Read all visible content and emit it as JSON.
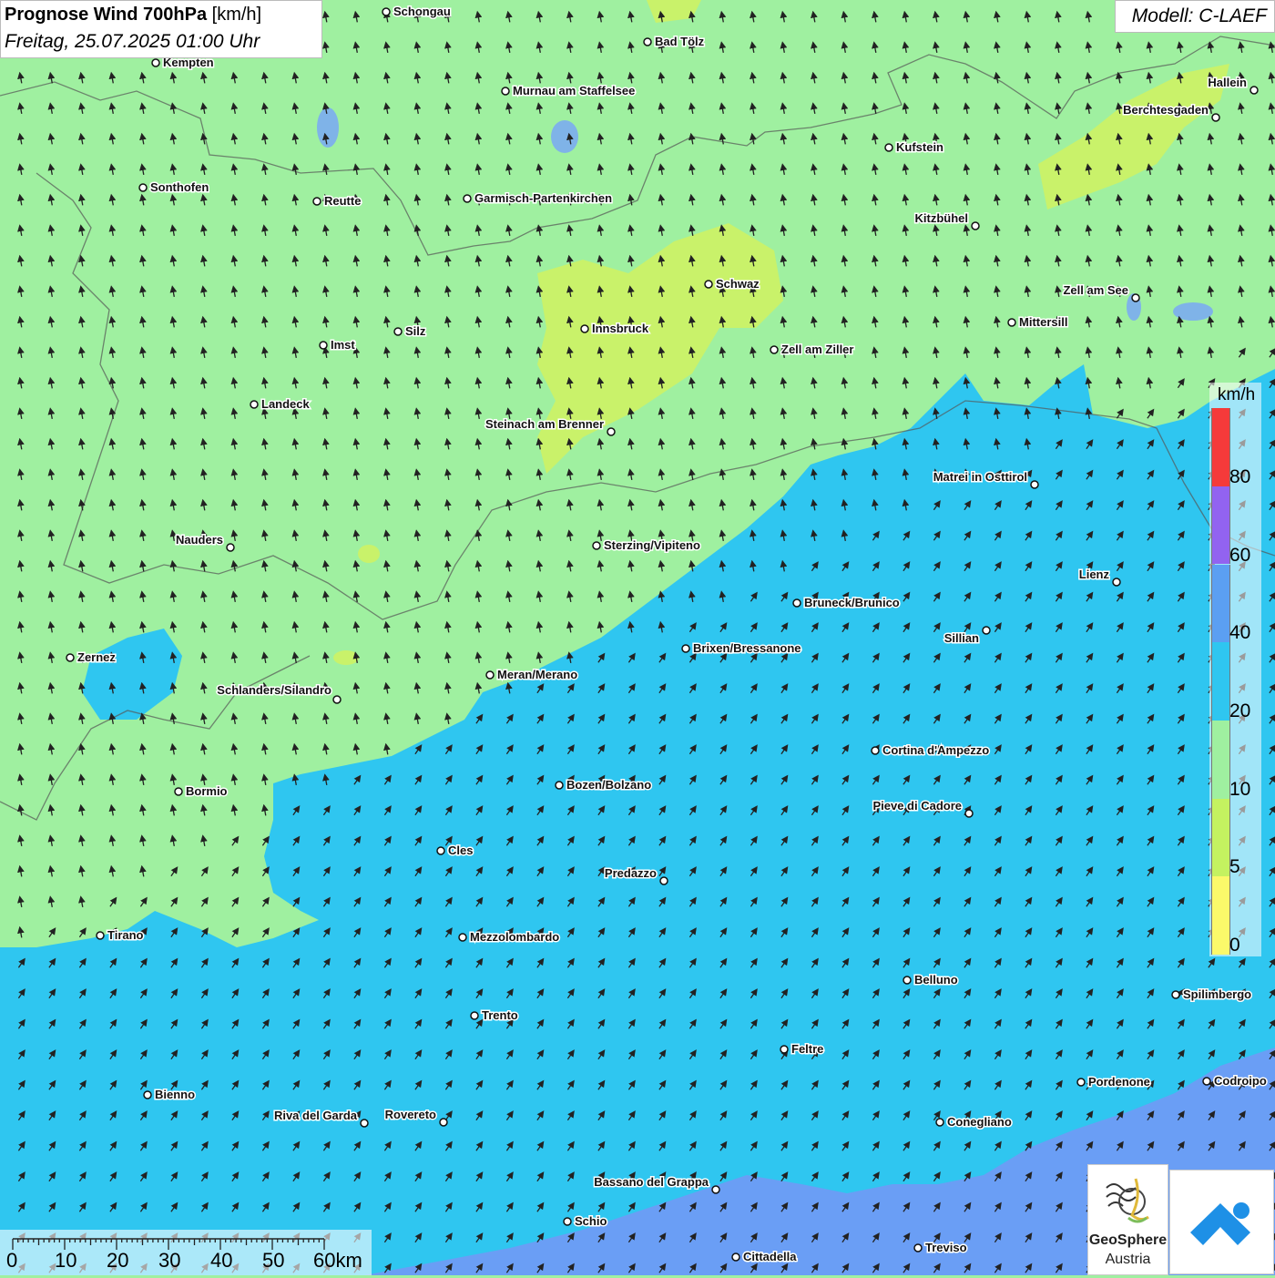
{
  "header": {
    "title_bold": "Prognose Wind 700hPa",
    "title_unit": "[km/h]",
    "datetime": "Freitag, 25.07.2025 01:00 Uhr",
    "model": "Modell: C-LAEF"
  },
  "legend": {
    "unit": "km/h",
    "ticks": [
      "0",
      "5",
      "10",
      "20",
      "40",
      "60",
      "80"
    ],
    "colors": [
      "#fbf96a",
      "#c4f260",
      "#9ff0a0",
      "#2fc6f0",
      "#5b9ff2",
      "#9263f0",
      "#f53a3a"
    ]
  },
  "scale_bar": {
    "labels": [
      "0",
      "10",
      "20",
      "30",
      "40",
      "50",
      "60km"
    ]
  },
  "cities": [
    {
      "name": "Schongau"
    },
    {
      "name": "Bad Tölz"
    },
    {
      "name": "Kempten"
    },
    {
      "name": "Murnau am Staffelsee"
    },
    {
      "name": "Hallein"
    },
    {
      "name": "Berchtesgaden"
    },
    {
      "name": "Kufstein"
    },
    {
      "name": "Sonthofen"
    },
    {
      "name": "Reutte"
    },
    {
      "name": "Garmisch-Partenkirchen"
    },
    {
      "name": "Kitzbühel"
    },
    {
      "name": "Schwaz"
    },
    {
      "name": "Zell am See"
    },
    {
      "name": "Innsbruck"
    },
    {
      "name": "Mittersill"
    },
    {
      "name": "Silz"
    },
    {
      "name": "Imst"
    },
    {
      "name": "Zell am Ziller"
    },
    {
      "name": "Landeck"
    },
    {
      "name": "Steinach am Brenner"
    },
    {
      "name": "Matrei in Osttirol"
    },
    {
      "name": "Nauders"
    },
    {
      "name": "Sterzing/Vipiteno"
    },
    {
      "name": "Lienz"
    },
    {
      "name": "Bruneck/Brunico"
    },
    {
      "name": "Sillian"
    },
    {
      "name": "Brixen/Bressanone"
    },
    {
      "name": "Zernez"
    },
    {
      "name": "Meran/Merano"
    },
    {
      "name": "Schlanders/Silandro"
    },
    {
      "name": "Cortina d'Ampezzo"
    },
    {
      "name": "Bozen/Bolzano"
    },
    {
      "name": "Bormio"
    },
    {
      "name": "Pieve di Cadore"
    },
    {
      "name": "Cles"
    },
    {
      "name": "Predazzo"
    },
    {
      "name": "Tirano"
    },
    {
      "name": "Mezzolombardo"
    },
    {
      "name": "Belluno"
    },
    {
      "name": "Spilimbergo"
    },
    {
      "name": "Trento"
    },
    {
      "name": "Feltre"
    },
    {
      "name": "Pordenone"
    },
    {
      "name": "Codroipo"
    },
    {
      "name": "Bienno"
    },
    {
      "name": "Riva del Garda"
    },
    {
      "name": "Rovereto"
    },
    {
      "name": "Conegliano"
    },
    {
      "name": "Bassano del Grappa"
    },
    {
      "name": "Schio"
    },
    {
      "name": "Treviso"
    },
    {
      "name": "Cittadella"
    }
  ],
  "logos": {
    "geosphere_name": "GeoSphere",
    "geosphere_country": "Austria"
  }
}
